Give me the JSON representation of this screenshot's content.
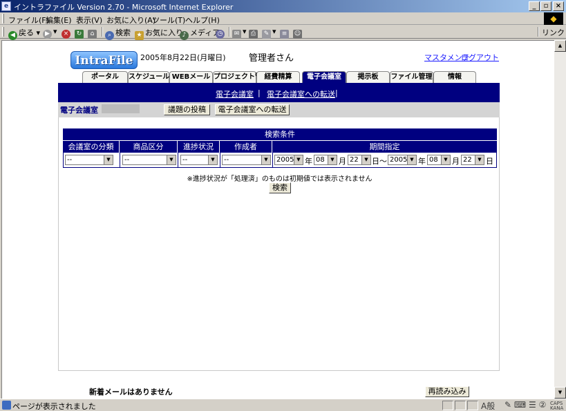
{
  "window": {
    "title": "イントラファイル Version 2.70 - Microsoft Internet Explorer",
    "minimize": "_",
    "maximize": "▫",
    "close": "×"
  },
  "menu": [
    "ファイル(F)",
    "編集(E)",
    "表示(V)",
    "お気に入り(A)",
    "ツール(T)",
    "ヘルプ(H)"
  ],
  "toolbar": {
    "back": "戻る",
    "search": "検索",
    "favorites": "お気に入り",
    "media": "メディア",
    "links": "リンク"
  },
  "header": {
    "logo": "IntraFile",
    "date": "2005年8月22日(月曜日)",
    "user": "管理者さん",
    "master_maintenance": "マスタメンテ",
    "logout": "ログアウト"
  },
  "tabs": [
    "ポータル",
    "スケジュール",
    "WEBメール",
    "プロジェクト管理",
    "経費精算",
    "電子会議室",
    "掲示板",
    "ファイル管理",
    "情報"
  ],
  "active_tab": "電子会議室",
  "subnav": {
    "link1": "電子会議室",
    "sep1": "|",
    "link2": "電子会議室への転送",
    "sep2": "|"
  },
  "section": {
    "title": "電子会議室",
    "post_button": "議題の投稿",
    "transfer_button": "電子会議室への転送"
  },
  "search": {
    "header": "検索条件",
    "columns": [
      "会議室の分類",
      "商品区分",
      "進捗状況",
      "作成者",
      "期間指定"
    ],
    "category_value": "--",
    "product_value": "--",
    "status_value": "--",
    "author_value": "--",
    "from_year": "2005",
    "from_month": "08",
    "from_day": "22",
    "to_year": "2005",
    "to_month": "08",
    "to_day": "22",
    "unit_year": "年",
    "unit_month": "月",
    "unit_day_range": "日～",
    "unit_day": "日",
    "note": "※進捗状況が「処理済」のものは初期値では表示されません",
    "search_button": "検索"
  },
  "footer": {
    "no_mail": "新着メールはありません",
    "reload": "再読み込み"
  },
  "status": {
    "text": "ページが表示されました",
    "ime": "A般"
  }
}
